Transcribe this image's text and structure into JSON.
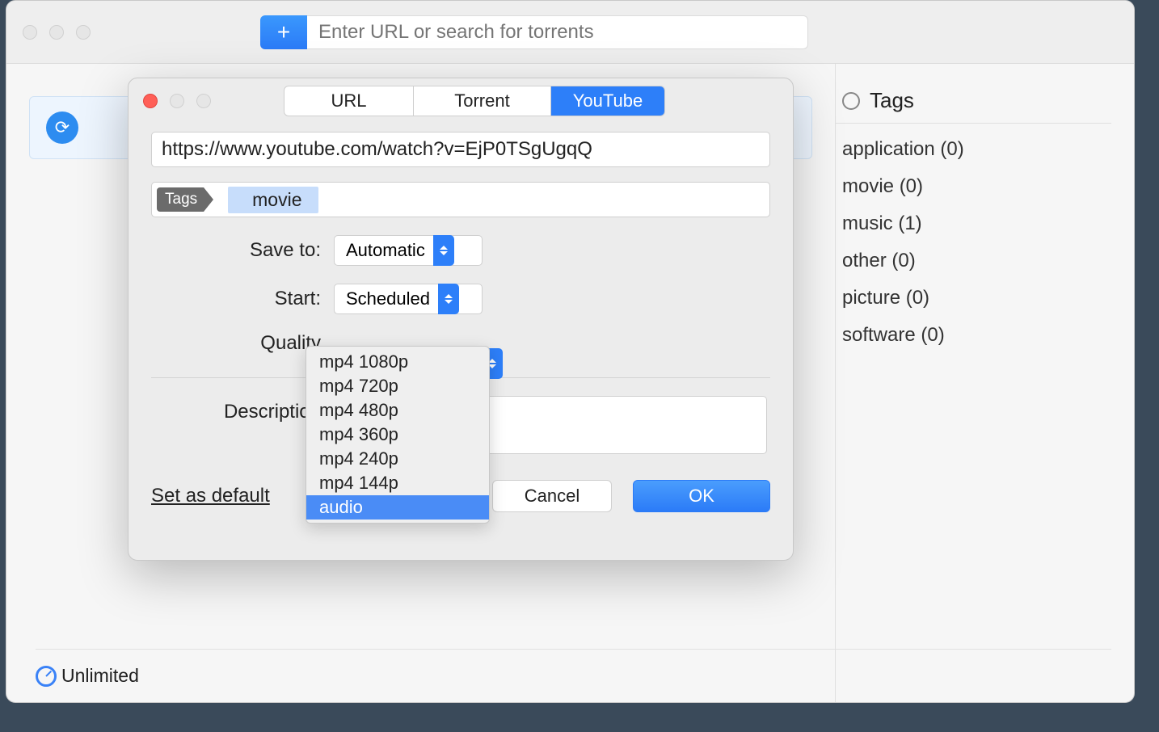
{
  "toolbar": {
    "search_placeholder": "Enter URL or search for torrents"
  },
  "sidebar": {
    "heading": "Tags",
    "items": [
      {
        "label": "application (0)"
      },
      {
        "label": "movie (0)"
      },
      {
        "label": "music (1)"
      },
      {
        "label": "other (0)"
      },
      {
        "label": "picture (0)"
      },
      {
        "label": "software (0)"
      }
    ]
  },
  "footer": {
    "status": "Unlimited"
  },
  "modal": {
    "tabs": {
      "url": "URL",
      "torrent": "Torrent",
      "youtube": "YouTube"
    },
    "url_value": "https://www.youtube.com/watch?v=EjP0TSgUgqQ",
    "tags_prefix": "Tags",
    "tag_value": "movie",
    "labels": {
      "save_to": "Save to:",
      "start": "Start:",
      "quality": "Quality",
      "description": "Description"
    },
    "save_to_value": "Automatic",
    "start_value": "Scheduled",
    "quality_options": [
      "mp4 1080p",
      "mp4 720p",
      "mp4 480p",
      "mp4 360p",
      "mp4 240p",
      "mp4 144p",
      "audio"
    ],
    "quality_selected_index": 6,
    "set_default": "Set as default",
    "cancel": "Cancel",
    "ok": "OK"
  }
}
